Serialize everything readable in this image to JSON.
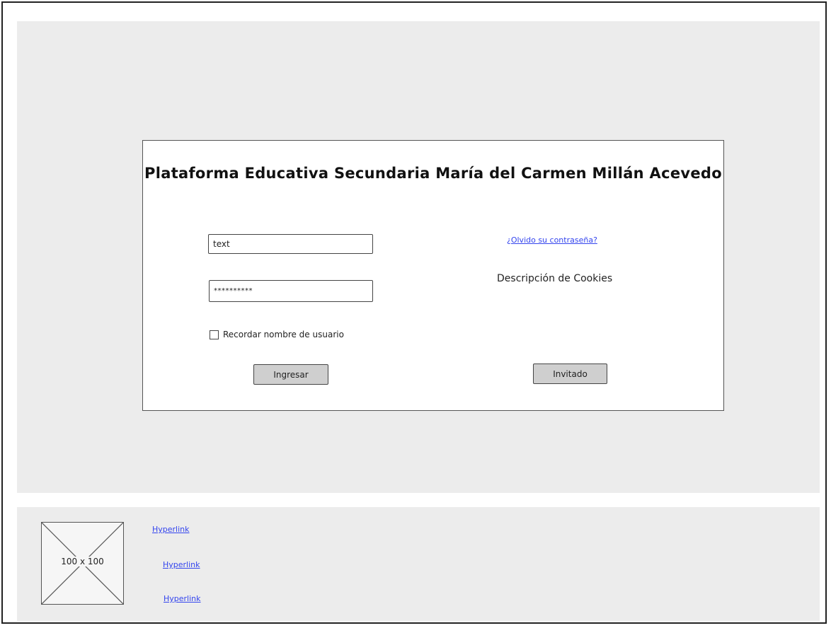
{
  "login": {
    "title": "Plataforma Educativa Secundaria María del Carmen Millán Acevedo",
    "username_value": "text",
    "password_value": "**********",
    "remember_label": "Recordar nombre de usuario",
    "login_button": "Ingresar",
    "forgot_link": "¿Olvido su contraseña?",
    "cookies_text": "Descripción de Cookies",
    "guest_button": "Invitado"
  },
  "footer": {
    "image_placeholder_label": "100 x 100",
    "links": [
      "Hyperlink",
      "Hyperlink",
      "Hyperlink"
    ]
  },
  "colors": {
    "background": "#ececec",
    "link": "#3344ee",
    "button": "#cfcfcf"
  }
}
